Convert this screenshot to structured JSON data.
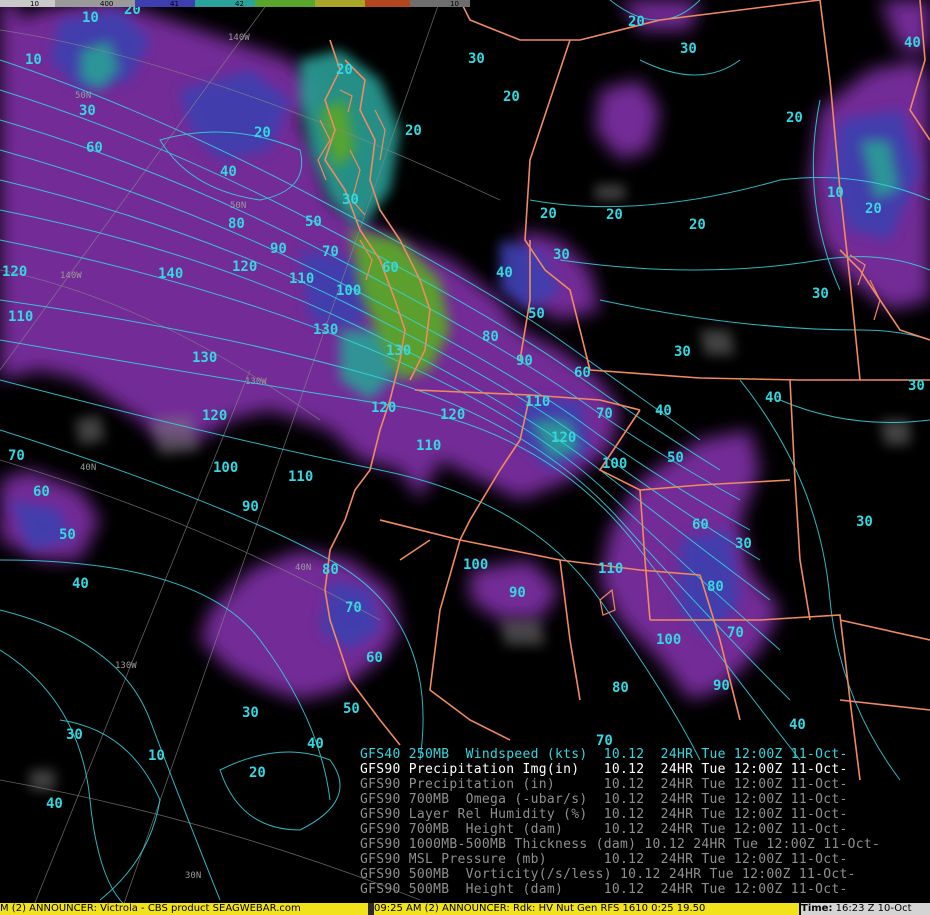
{
  "map": {
    "region": "Pacific Northwest / Western US",
    "colors": {
      "contour": "#35d7e0",
      "border": "#f08050",
      "precip_light": "#8f3fb0",
      "precip_mid": "#2d6fa8",
      "precip_heavy": "#2aa39a",
      "precip_max": "#5aa32a",
      "background": "#000000",
      "grid": "#9a9a9a"
    },
    "contour_labels": [
      "10",
      "20",
      "30",
      "40",
      "50",
      "60",
      "70",
      "80",
      "90",
      "100",
      "110",
      "120",
      "130",
      "140"
    ],
    "grid_labels": [
      "140W",
      "50N",
      "140W",
      "130W",
      "40N",
      "40N",
      "130W",
      "30N",
      "50N"
    ]
  },
  "colorbar": {
    "ticks": [
      "10",
      "400",
      "41",
      "42",
      "",
      "",
      "",
      "10"
    ]
  },
  "legend": [
    {
      "text": "GFS40 250MB  Windspeed (kts)  10.12  24HR Tue 12:00Z 11-Oct-",
      "style": "cyan"
    },
    {
      "text": "GFS90 Precipitation Img(in)   10.12  24HR Tue 12:00Z 11-Oct-",
      "style": "active"
    },
    {
      "text": "GFS90 Precipitation (in)      10.12  24HR Tue 12:00Z 11-Oct-",
      "style": "dim"
    },
    {
      "text": "GFS90 700MB  Omega (-ubar/s)  10.12  24HR Tue 12:00Z 11-Oct-",
      "style": "dim"
    },
    {
      "text": "GFS90 Layer Rel Humidity (%)  10.12  24HR Tue 12:00Z 11-Oct-",
      "style": "dim"
    },
    {
      "text": "GFS90 700MB  Height (dam)     10.12  24HR Tue 12:00Z 11-Oct-",
      "style": "dim"
    },
    {
      "text": "GFS90 1000MB-500MB Thickness (dam) 10.12 24HR Tue 12:00Z 11-Oct-",
      "style": "dim"
    },
    {
      "text": "GFS90 MSL Pressure (mb)       10.12  24HR Tue 12:00Z 11-Oct-",
      "style": "dim"
    },
    {
      "text": "GFS90 500MB  Vorticity(/s/less) 10.12 24HR Tue 12:00Z 11-Oct-",
      "style": "dim"
    },
    {
      "text": "GFS90 500MB  Height (dam)     10.12  24HR Tue 12:00Z 11-Oct-",
      "style": "dim"
    }
  ],
  "statusbar": {
    "ticker_left": "M (2) ANNOUNCER: Victrola - CBS product SEAGWEBAR.com",
    "ticker_right": "09:25 AM (2) ANNOUNCER: Rdk: HV  Nut Gen RFS 1610  0:25  19.50",
    "time_label": "Time:",
    "time_value": "16:23 Z 10-Oct"
  }
}
